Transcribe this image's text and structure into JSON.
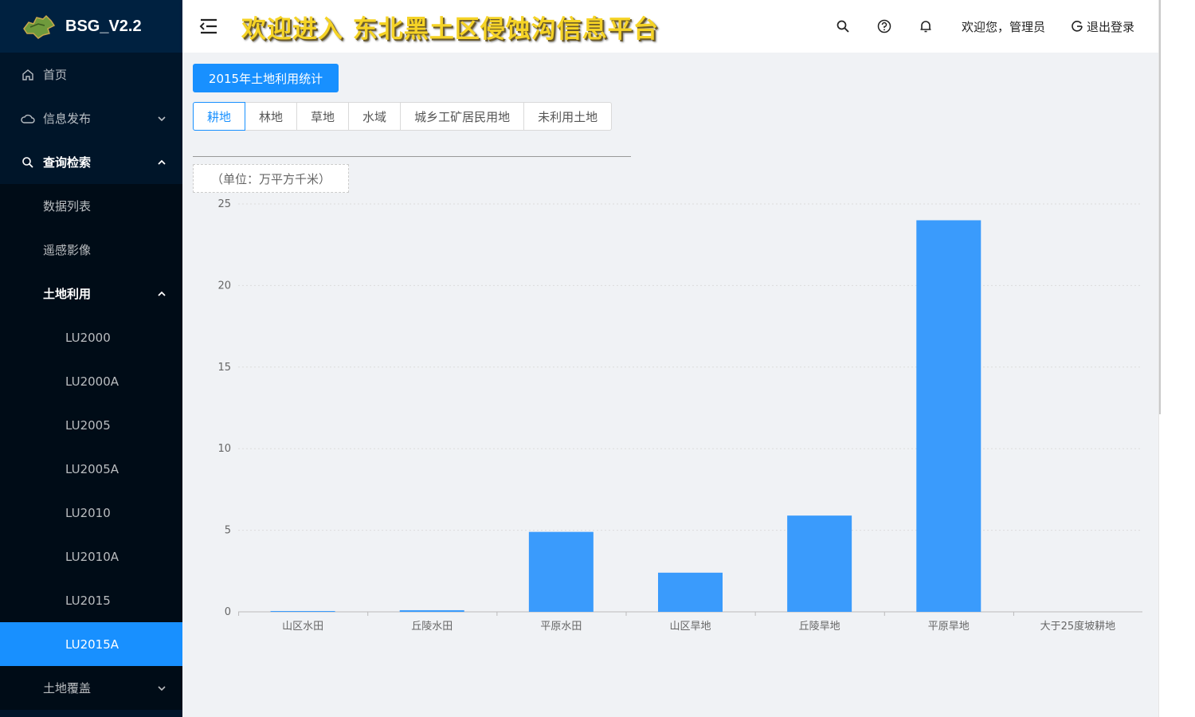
{
  "app": {
    "name": "BSG_V2.2"
  },
  "header": {
    "title": "欢迎进入 东北黑土区侵蚀沟信息平台",
    "user": "欢迎您，管理员",
    "logout": "退出登录",
    "icons": [
      "search-icon",
      "help-icon",
      "bell-icon"
    ]
  },
  "sidebar": {
    "home": "首页",
    "info": "信息发布",
    "query": "查询检索",
    "data_list": "数据列表",
    "remote": "遥感影像",
    "land_use": "土地利用",
    "land_use_items": [
      "LU2000",
      "LU2000A",
      "LU2005",
      "LU2005A",
      "LU2010",
      "LU2010A",
      "LU2015",
      "LU2015A"
    ],
    "land_cover": "土地覆盖"
  },
  "main": {
    "stat_button": "2015年土地利用统计",
    "tabs": [
      "耕地",
      "林地",
      "草地",
      "水域",
      "城乡工矿居民用地",
      "未利用土地"
    ],
    "unit": "（单位：万平方千米）"
  },
  "colors": {
    "accent": "#1890ff",
    "bar": "#3a9bfc",
    "sidebar": "#001529"
  },
  "chart_data": {
    "type": "bar",
    "categories": [
      "山区水田",
      "丘陵水田",
      "平原水田",
      "山区旱地",
      "丘陵旱地",
      "平原旱地",
      "大于25度坡耕地"
    ],
    "values": [
      0.05,
      0.1,
      4.9,
      2.4,
      5.9,
      24.0,
      0
    ],
    "ylim": [
      0,
      25
    ],
    "yticks": [
      "0",
      "5",
      "10",
      "15",
      "20",
      "25"
    ],
    "grid": true
  }
}
